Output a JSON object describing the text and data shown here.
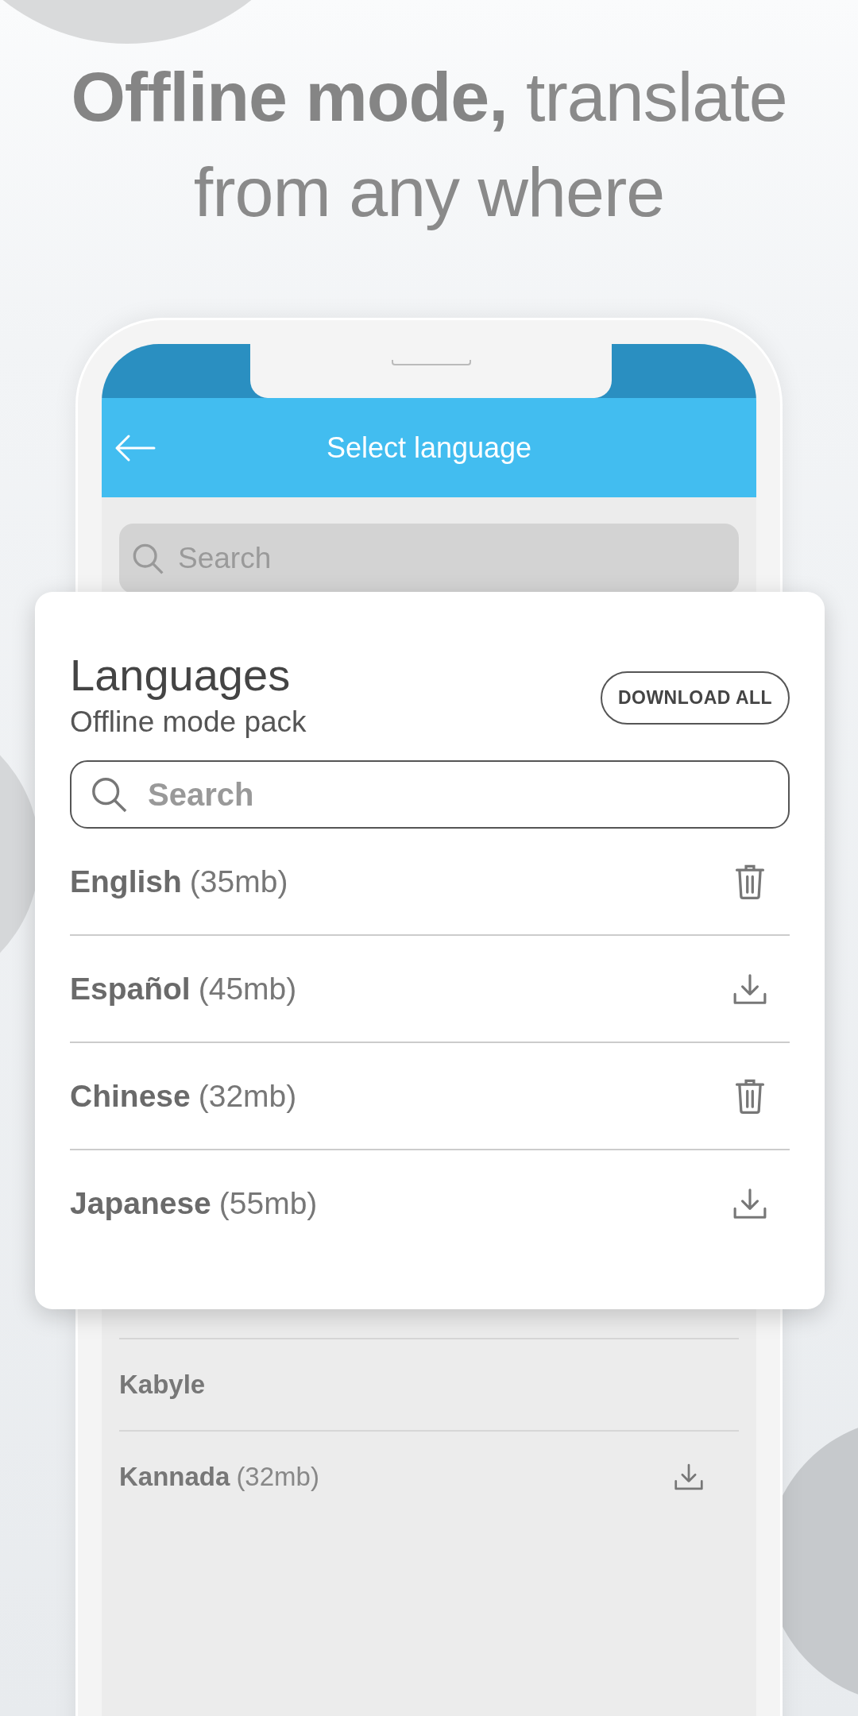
{
  "headline": "**Offline mode,** translate from any where",
  "app_bar": {
    "title": "Select language"
  },
  "screen_search": {
    "placeholder": "Search"
  },
  "card": {
    "title": "Languages",
    "subtitle": "Offline mode pack",
    "download_all": "DOWNLOAD ALL",
    "search": {
      "placeholder": "Search"
    },
    "languages": [
      {
        "name": "English",
        "size": "(35mb)",
        "downloaded": true
      },
      {
        "name": "Español",
        "size": "(45mb)",
        "downloaded": false
      },
      {
        "name": "Chinese",
        "size": "(32mb)",
        "downloaded": true
      },
      {
        "name": "Japanese",
        "size": "(55mb)",
        "downloaded": false
      }
    ]
  },
  "background_list": [
    {
      "name": "Kabyle"
    },
    {
      "name": "Kannada",
      "size": "(32mb)",
      "downloaded": false
    }
  ]
}
